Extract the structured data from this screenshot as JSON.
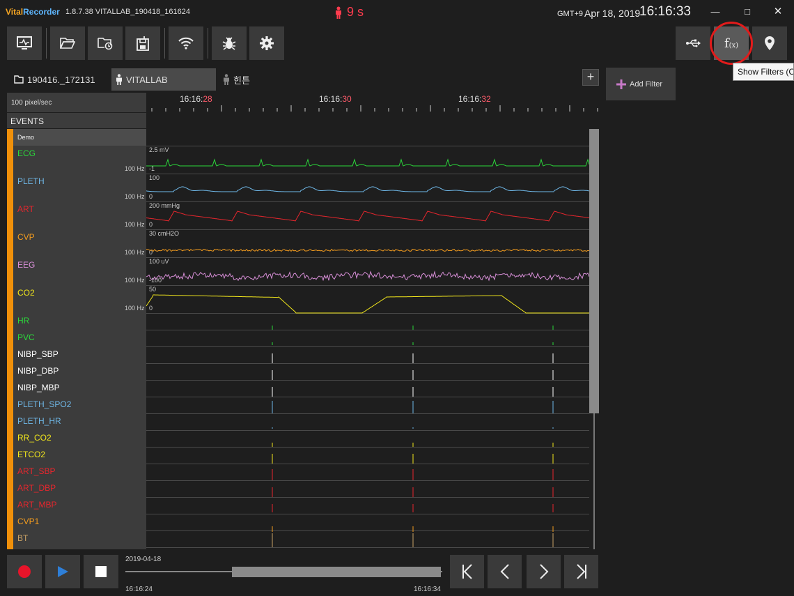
{
  "titlebar": {
    "app_vital": "Vital",
    "app_recorder": "Recorder",
    "version": "1.8.7.38 VITALLAB_190418_161624",
    "rec_time": "9 s",
    "timezone": "GMT+9",
    "date": "Apr 18, 2019",
    "clock": "16:16:33"
  },
  "tabs": {
    "file": "190416._172131",
    "active": "VITALLAB",
    "other": "힌튼",
    "add": "+"
  },
  "filters": {
    "add_filter": "Add Filter",
    "tooltip": "Show Filters (Ctrl+F)"
  },
  "timeline": {
    "speed": "100 pixel/sec",
    "ticks": [
      {
        "base": "16:16:",
        "sec": "28"
      },
      {
        "base": "16:16:",
        "sec": "30"
      },
      {
        "base": "16:16:",
        "sec": "32"
      }
    ]
  },
  "events": {
    "label": "EVENTS",
    "demo": "Demo"
  },
  "tracks": [
    {
      "name": "ECG",
      "color": "#2bd93b",
      "hz": "100 Hz",
      "max": "2.5 mV",
      "min": "-1"
    },
    {
      "name": "PLETH",
      "color": "#6fb8e8",
      "hz": "100 Hz",
      "max": "100",
      "min": "0"
    },
    {
      "name": "ART",
      "color": "#e8262d",
      "hz": "100 Hz",
      "max": "200 mmHg",
      "min": "0"
    },
    {
      "name": "CVP",
      "color": "#f39c1f",
      "hz": "100 Hz",
      "max": "30 cmH2O",
      "min": "0"
    },
    {
      "name": "EEG",
      "color": "#d88fd8",
      "hz": "100 Hz",
      "max": "100 uV",
      "min": "-100"
    },
    {
      "name": "CO2",
      "color": "#f2e71c",
      "hz": "100 Hz",
      "max": "50",
      "min": "0"
    }
  ],
  "numerics": [
    {
      "name": "HR",
      "color": "#2bd93b"
    },
    {
      "name": "PVC",
      "color": "#2bd93b"
    },
    {
      "name": "NIBP_SBP",
      "color": "#ffffff"
    },
    {
      "name": "NIBP_DBP",
      "color": "#ffffff"
    },
    {
      "name": "NIBP_MBP",
      "color": "#ffffff"
    },
    {
      "name": "PLETH_SPO2",
      "color": "#6fb8e8"
    },
    {
      "name": "PLETH_HR",
      "color": "#6fb8e8"
    },
    {
      "name": "RR_CO2",
      "color": "#f2e71c"
    },
    {
      "name": "ETCO2",
      "color": "#f2e71c"
    },
    {
      "name": "ART_SBP",
      "color": "#e8262d"
    },
    {
      "name": "ART_DBP",
      "color": "#e8262d"
    },
    {
      "name": "ART_MBP",
      "color": "#e8262d"
    },
    {
      "name": "CVP1",
      "color": "#f39c1f"
    },
    {
      "name": "BT",
      "color": "#c8a165"
    }
  ],
  "playback": {
    "date": "2019-04-18",
    "start": "16:16:24",
    "end": "16:16:34"
  },
  "colors": {
    "accent_red": "#ff3c4e",
    "highlight_circle": "#e21b1b"
  }
}
